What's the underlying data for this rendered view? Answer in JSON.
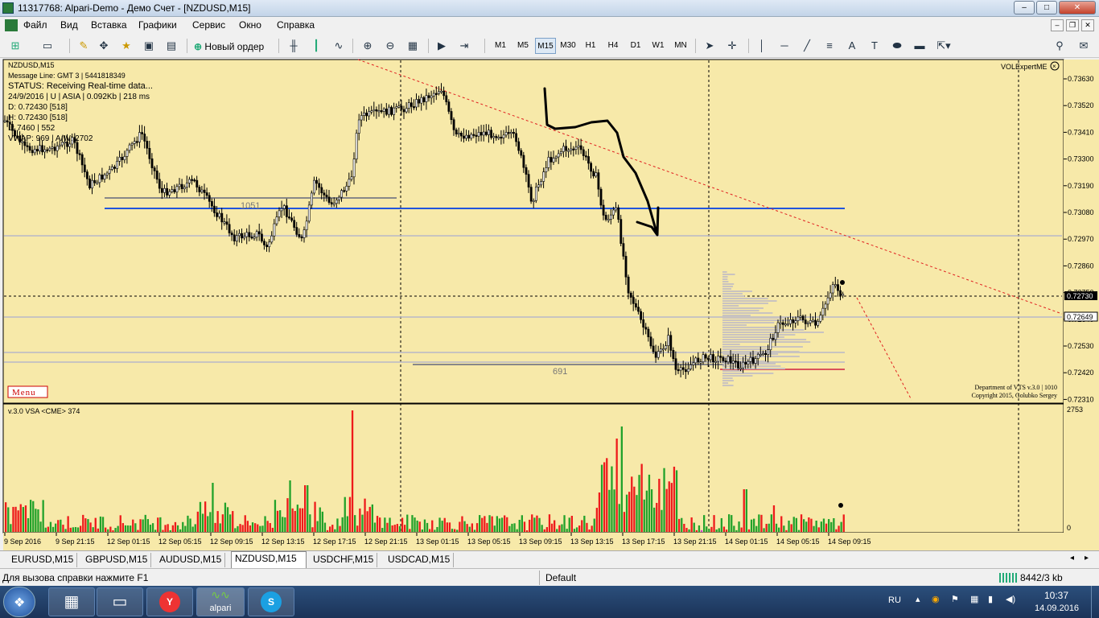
{
  "window": {
    "title": "11317768: Alpari-Demo - Демо Счет - [NZDUSD,M15]",
    "min": "–",
    "max": "□",
    "close": "✕"
  },
  "menu": [
    "Файл",
    "Вид",
    "Вставка",
    "Графики",
    "Сервис",
    "Окно",
    "Справка"
  ],
  "toolbar": {
    "new_order": "Новый ордер",
    "timeframes": [
      "M1",
      "M5",
      "M15",
      "M30",
      "H1",
      "H4",
      "D1",
      "W1",
      "MN"
    ],
    "selected_timeframe": "M15",
    "text_tool": "A"
  },
  "chart": {
    "symbol": "NZDUSD,M15",
    "info_lines": [
      "Message Line: GMT 3 | 5441818349",
      "STATUS:  Receiving Real-time data...",
      "24/9/2016 | U | ASIA | 0.092Kb | 218 ms",
      "D: 0.72430  [518]",
      "H: 0.72430  [518]",
      "L: 7460 | 552",
      "VWAP: 969 | A/W: 2702"
    ],
    "menu_button": "Menu",
    "top_right_label": "VOLExpertME",
    "box_label_1": "1051",
    "box_label_2": "691",
    "footer_1": "Department of VTS v.3.0 | 1010",
    "footer_2": "Copyright 2015, Golubko Sergey",
    "price_labels": [
      "0.73630",
      "0.73520",
      "0.73410",
      "0.73300",
      "0.73190",
      "0.73080",
      "0.72970",
      "0.72860",
      "0.72750",
      "0.72640",
      "0.72530",
      "0.72420",
      "0.72310"
    ],
    "current_price_1": "0.72730",
    "current_price_2": "0.72649",
    "volume_title": "v.3.0 VSA <CME> 374",
    "volume_max": "2753",
    "volume_zero": "0",
    "time_labels": [
      "9 Sep 2016",
      "9 Sep 21:15",
      "12 Sep 01:15",
      "12 Sep 05:15",
      "12 Sep 09:15",
      "12 Sep 13:15",
      "12 Sep 17:15",
      "12 Sep 21:15",
      "13 Sep 01:15",
      "13 Sep 05:15",
      "13 Sep 09:15",
      "13 Sep 13:15",
      "13 Sep 17:15",
      "13 Sep 21:15",
      "14 Sep 01:15",
      "14 Sep 05:15",
      "14 Sep 09:15"
    ]
  },
  "tabs": [
    "EURUSD,M15",
    "GBPUSD,M15",
    "AUDUSD,M15",
    "NZDUSD,M15",
    "USDCHF,M15",
    "USDCAD,M15"
  ],
  "active_tab": "NZDUSD,M15",
  "status": {
    "help": "Для вызова справки нажмите F1",
    "profile": "Default",
    "traffic": "8442/3 kb"
  },
  "taskbar": {
    "lang": "RU",
    "time": "10:37",
    "date": "14.09.2016",
    "alpari_label": "alpari"
  }
}
